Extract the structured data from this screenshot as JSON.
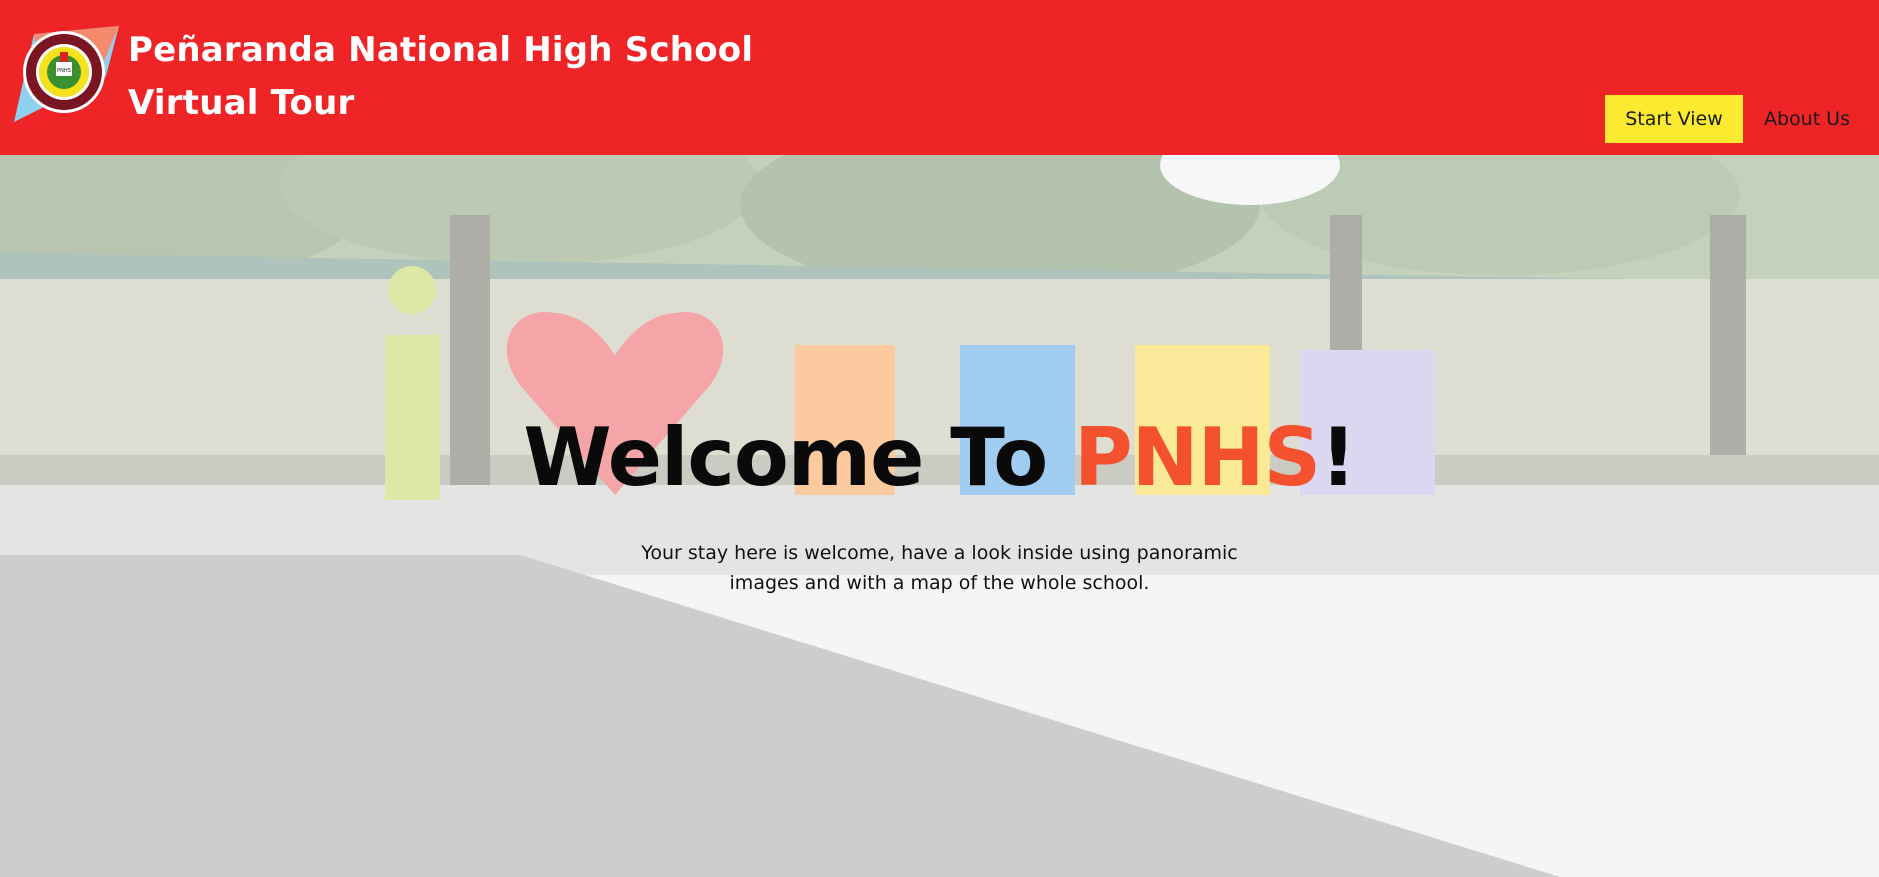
{
  "header": {
    "title_line1": "Peñaranda National High School",
    "title_line2": "Virtual Tour",
    "logo_icon": "school-seal-logo",
    "bg_color": "#ee2427"
  },
  "nav": {
    "start_label": "Start View",
    "about_label": "About Us",
    "start_bg": "#fbea2f"
  },
  "hero": {
    "welcome_prefix": "Welcome To ",
    "welcome_accent": "PNHS",
    "welcome_suffix": "!",
    "accent_color": "#f4512f",
    "subtitle_line1": "Your stay here is welcome, have a look inside using panoramic",
    "subtitle_line2": "images and with a map of the whole school."
  }
}
